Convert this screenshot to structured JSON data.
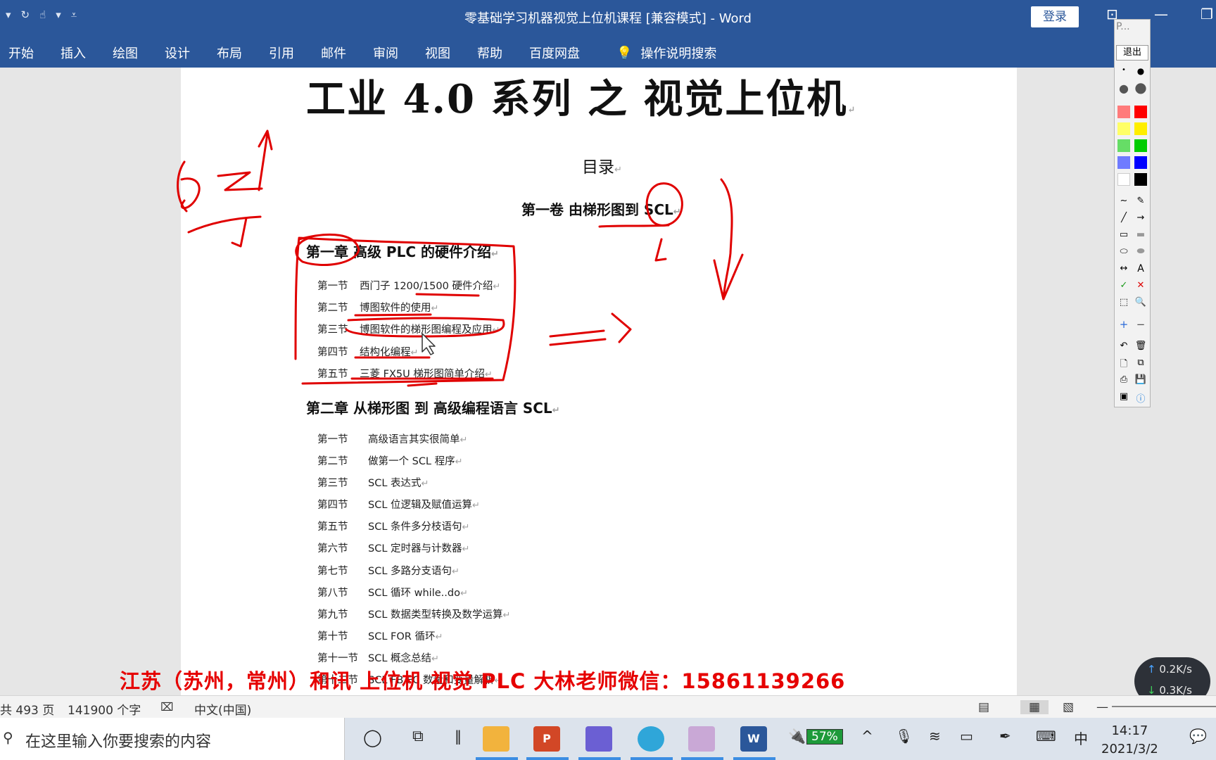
{
  "app": {
    "title": "零基础学习机器视觉上位机课程 [兼容模式]  -  Word",
    "login_label": "登录",
    "tabs": [
      "开始",
      "插入",
      "绘图",
      "设计",
      "布局",
      "引用",
      "邮件",
      "审阅",
      "视图",
      "帮助",
      "百度网盘"
    ],
    "tell_me": "操作说明搜索"
  },
  "document": {
    "main_heading": "工业 4.0 系列    之   视觉上位机",
    "toc_heading": "目录",
    "volume": "第一卷  由梯形图到 SCL",
    "chapter1": {
      "title": "第一章   高级 PLC 的硬件介绍",
      "sections": [
        {
          "num": "第一节",
          "text": "西门子 1200/1500 硬件介绍"
        },
        {
          "num": "第二节",
          "text": "博图软件的使用"
        },
        {
          "num": "第三节",
          "text": "博图软件的梯形图编程及应用"
        },
        {
          "num": "第四节",
          "text": "结构化编程"
        },
        {
          "num": "第五节",
          "text": "三菱 FX5U 梯形图简单介绍"
        }
      ]
    },
    "chapter2": {
      "title": "第二章   从梯形图  到  高级编程语言 SCL",
      "sections": [
        {
          "num": "第一节",
          "text": "高级语言其实很简单"
        },
        {
          "num": "第二节",
          "text": "做第一个 SCL 程序"
        },
        {
          "num": "第三节",
          "text": "SCL 表达式"
        },
        {
          "num": "第四节",
          "text": "SCL 位逻辑及赋值运算"
        },
        {
          "num": "第五节",
          "text": "SCL 条件多分枝语句"
        },
        {
          "num": "第六节",
          "text": "SCL 定时器与计数器"
        },
        {
          "num": "第七节",
          "text": "SCL 多路分支语句"
        },
        {
          "num": "第八节",
          "text": "SCL 循环 while..do"
        },
        {
          "num": "第九节",
          "text": "SCL 数据类型转换及数学运算"
        },
        {
          "num": "第十节",
          "text": "SCL FOR 循环"
        },
        {
          "num": "第十一节",
          "text": "SCL 概念总结"
        },
        {
          "num": "第十二节",
          "text": "SCL FB,FC 数量和变量解析"
        }
      ]
    },
    "overlay_banner": "江苏（苏州，常州）和讯 上位机 视觉 PLC 大林老师微信：15861139266"
  },
  "statusbar": {
    "pages": "共 493 页",
    "words": "141900 个字",
    "language": "中文(中国)"
  },
  "pen_tool": {
    "title": "P...",
    "exit_label": "退出",
    "colors": [
      "#ff7b7b",
      "#ff0000",
      "#ffff66",
      "#ffee00",
      "#66dd66",
      "#00cc00",
      "#6f7bff",
      "#0000ff",
      "#ffffff",
      "#000000"
    ]
  },
  "network": {
    "up": "0.2K/s",
    "down": "0.3K/s"
  },
  "taskbar": {
    "search_placeholder": "在这里输入你要搜索的内容",
    "battery": "57%",
    "ime": "中",
    "time": "14:17",
    "date": "2021/3/2"
  }
}
